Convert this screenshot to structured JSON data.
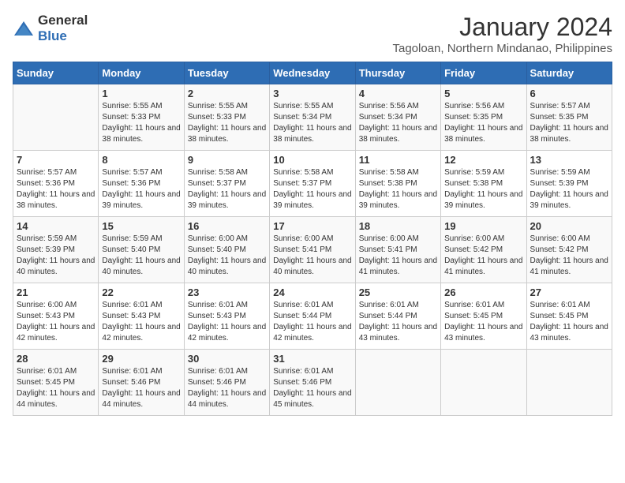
{
  "logo": {
    "general": "General",
    "blue": "Blue"
  },
  "title": "January 2024",
  "subtitle": "Tagoloan, Northern Mindanao, Philippines",
  "days": [
    "Sunday",
    "Monday",
    "Tuesday",
    "Wednesday",
    "Thursday",
    "Friday",
    "Saturday"
  ],
  "weeks": [
    [
      {
        "day": "",
        "sunrise": "",
        "sunset": "",
        "daylight": ""
      },
      {
        "day": "1",
        "sunrise": "Sunrise: 5:55 AM",
        "sunset": "Sunset: 5:33 PM",
        "daylight": "Daylight: 11 hours and 38 minutes."
      },
      {
        "day": "2",
        "sunrise": "Sunrise: 5:55 AM",
        "sunset": "Sunset: 5:33 PM",
        "daylight": "Daylight: 11 hours and 38 minutes."
      },
      {
        "day": "3",
        "sunrise": "Sunrise: 5:55 AM",
        "sunset": "Sunset: 5:34 PM",
        "daylight": "Daylight: 11 hours and 38 minutes."
      },
      {
        "day": "4",
        "sunrise": "Sunrise: 5:56 AM",
        "sunset": "Sunset: 5:34 PM",
        "daylight": "Daylight: 11 hours and 38 minutes."
      },
      {
        "day": "5",
        "sunrise": "Sunrise: 5:56 AM",
        "sunset": "Sunset: 5:35 PM",
        "daylight": "Daylight: 11 hours and 38 minutes."
      },
      {
        "day": "6",
        "sunrise": "Sunrise: 5:57 AM",
        "sunset": "Sunset: 5:35 PM",
        "daylight": "Daylight: 11 hours and 38 minutes."
      }
    ],
    [
      {
        "day": "7",
        "sunrise": "Sunrise: 5:57 AM",
        "sunset": "Sunset: 5:36 PM",
        "daylight": "Daylight: 11 hours and 38 minutes."
      },
      {
        "day": "8",
        "sunrise": "Sunrise: 5:57 AM",
        "sunset": "Sunset: 5:36 PM",
        "daylight": "Daylight: 11 hours and 39 minutes."
      },
      {
        "day": "9",
        "sunrise": "Sunrise: 5:58 AM",
        "sunset": "Sunset: 5:37 PM",
        "daylight": "Daylight: 11 hours and 39 minutes."
      },
      {
        "day": "10",
        "sunrise": "Sunrise: 5:58 AM",
        "sunset": "Sunset: 5:37 PM",
        "daylight": "Daylight: 11 hours and 39 minutes."
      },
      {
        "day": "11",
        "sunrise": "Sunrise: 5:58 AM",
        "sunset": "Sunset: 5:38 PM",
        "daylight": "Daylight: 11 hours and 39 minutes."
      },
      {
        "day": "12",
        "sunrise": "Sunrise: 5:59 AM",
        "sunset": "Sunset: 5:38 PM",
        "daylight": "Daylight: 11 hours and 39 minutes."
      },
      {
        "day": "13",
        "sunrise": "Sunrise: 5:59 AM",
        "sunset": "Sunset: 5:39 PM",
        "daylight": "Daylight: 11 hours and 39 minutes."
      }
    ],
    [
      {
        "day": "14",
        "sunrise": "Sunrise: 5:59 AM",
        "sunset": "Sunset: 5:39 PM",
        "daylight": "Daylight: 11 hours and 40 minutes."
      },
      {
        "day": "15",
        "sunrise": "Sunrise: 5:59 AM",
        "sunset": "Sunset: 5:40 PM",
        "daylight": "Daylight: 11 hours and 40 minutes."
      },
      {
        "day": "16",
        "sunrise": "Sunrise: 6:00 AM",
        "sunset": "Sunset: 5:40 PM",
        "daylight": "Daylight: 11 hours and 40 minutes."
      },
      {
        "day": "17",
        "sunrise": "Sunrise: 6:00 AM",
        "sunset": "Sunset: 5:41 PM",
        "daylight": "Daylight: 11 hours and 40 minutes."
      },
      {
        "day": "18",
        "sunrise": "Sunrise: 6:00 AM",
        "sunset": "Sunset: 5:41 PM",
        "daylight": "Daylight: 11 hours and 41 minutes."
      },
      {
        "day": "19",
        "sunrise": "Sunrise: 6:00 AM",
        "sunset": "Sunset: 5:42 PM",
        "daylight": "Daylight: 11 hours and 41 minutes."
      },
      {
        "day": "20",
        "sunrise": "Sunrise: 6:00 AM",
        "sunset": "Sunset: 5:42 PM",
        "daylight": "Daylight: 11 hours and 41 minutes."
      }
    ],
    [
      {
        "day": "21",
        "sunrise": "Sunrise: 6:00 AM",
        "sunset": "Sunset: 5:43 PM",
        "daylight": "Daylight: 11 hours and 42 minutes."
      },
      {
        "day": "22",
        "sunrise": "Sunrise: 6:01 AM",
        "sunset": "Sunset: 5:43 PM",
        "daylight": "Daylight: 11 hours and 42 minutes."
      },
      {
        "day": "23",
        "sunrise": "Sunrise: 6:01 AM",
        "sunset": "Sunset: 5:43 PM",
        "daylight": "Daylight: 11 hours and 42 minutes."
      },
      {
        "day": "24",
        "sunrise": "Sunrise: 6:01 AM",
        "sunset": "Sunset: 5:44 PM",
        "daylight": "Daylight: 11 hours and 42 minutes."
      },
      {
        "day": "25",
        "sunrise": "Sunrise: 6:01 AM",
        "sunset": "Sunset: 5:44 PM",
        "daylight": "Daylight: 11 hours and 43 minutes."
      },
      {
        "day": "26",
        "sunrise": "Sunrise: 6:01 AM",
        "sunset": "Sunset: 5:45 PM",
        "daylight": "Daylight: 11 hours and 43 minutes."
      },
      {
        "day": "27",
        "sunrise": "Sunrise: 6:01 AM",
        "sunset": "Sunset: 5:45 PM",
        "daylight": "Daylight: 11 hours and 43 minutes."
      }
    ],
    [
      {
        "day": "28",
        "sunrise": "Sunrise: 6:01 AM",
        "sunset": "Sunset: 5:45 PM",
        "daylight": "Daylight: 11 hours and 44 minutes."
      },
      {
        "day": "29",
        "sunrise": "Sunrise: 6:01 AM",
        "sunset": "Sunset: 5:46 PM",
        "daylight": "Daylight: 11 hours and 44 minutes."
      },
      {
        "day": "30",
        "sunrise": "Sunrise: 6:01 AM",
        "sunset": "Sunset: 5:46 PM",
        "daylight": "Daylight: 11 hours and 44 minutes."
      },
      {
        "day": "31",
        "sunrise": "Sunrise: 6:01 AM",
        "sunset": "Sunset: 5:46 PM",
        "daylight": "Daylight: 11 hours and 45 minutes."
      },
      {
        "day": "",
        "sunrise": "",
        "sunset": "",
        "daylight": ""
      },
      {
        "day": "",
        "sunrise": "",
        "sunset": "",
        "daylight": ""
      },
      {
        "day": "",
        "sunrise": "",
        "sunset": "",
        "daylight": ""
      }
    ]
  ]
}
